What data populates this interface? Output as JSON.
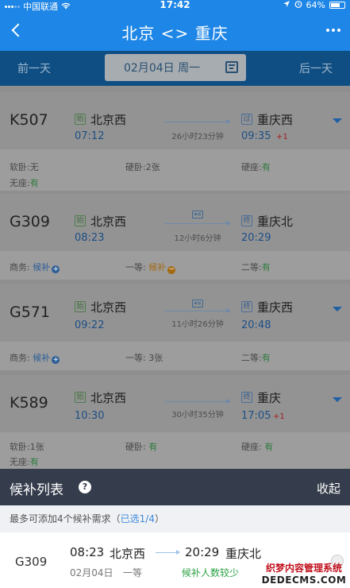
{
  "status_bar": {
    "carrier": "中国联通",
    "time": "17:42",
    "battery": "64%"
  },
  "header": {
    "title": "北京 <> 重庆"
  },
  "date_nav": {
    "prev": "前一天",
    "date": "02月04日 周一",
    "next": "后一天"
  },
  "badges": {
    "origin": "始",
    "pass": "过",
    "terminal": "终"
  },
  "trains": [
    {
      "number": "K507",
      "from_station": "北京西",
      "from_time": "07:12",
      "duration": "26小时23分钟",
      "to_station": "重庆西",
      "to_time": "09:35",
      "day_offset": "+1",
      "seats_row1": [
        {
          "label": "软卧:",
          "value": "无"
        },
        {
          "label": "硬卧:",
          "value": "2张"
        },
        {
          "label": "硬座:",
          "value": "有"
        }
      ],
      "seats_row2": [
        {
          "label": "无座:",
          "value": "有"
        }
      ]
    },
    {
      "number": "G309",
      "from_station": "北京西",
      "from_time": "08:23",
      "duration": "12小时6分钟",
      "to_station": "重庆北",
      "to_time": "20:29",
      "seats_row1": [
        {
          "label": "商务:",
          "value": "候补"
        },
        {
          "label": "一等:",
          "value": "候补"
        },
        {
          "label": "二等:",
          "value": "有"
        }
      ]
    },
    {
      "number": "G571",
      "from_station": "北京西",
      "from_time": "09:22",
      "duration": "11小时26分钟",
      "to_station": "重庆西",
      "to_time": "20:48",
      "seats_row1": [
        {
          "label": "商务:",
          "value": "候补"
        },
        {
          "label": "一等:",
          "value": "3张"
        },
        {
          "label": "二等:",
          "value": "有"
        }
      ]
    },
    {
      "number": "K589",
      "from_station": "北京西",
      "from_time": "10:30",
      "duration": "30小时35分钟",
      "to_station": "重庆",
      "to_time": "17:05",
      "day_offset": "+1",
      "seats_row1": [
        {
          "label": "软卧:",
          "value": "1张"
        },
        {
          "label": "硬卧:",
          "value": "有"
        },
        {
          "label": "硬座:",
          "value": "有"
        }
      ],
      "seats_row2": [
        {
          "label": "无座:",
          "value": "有"
        }
      ]
    }
  ],
  "waitlist": {
    "title": "候补列表",
    "help": "?",
    "collapse": "收起",
    "hint": "最多可添加4个候补需求（",
    "hint_selected": "已选1/4",
    "hint_end": "）",
    "item": {
      "train": "G309",
      "dep_time": "08:23",
      "dep_station": "北京西",
      "arr_time": "20:29",
      "arr_station": "重庆北",
      "date": "02月04日",
      "class": "一等",
      "status": "候补人数较少"
    }
  },
  "watermark": {
    "line1": "织梦内容管理系统",
    "line2": "DEDECMS.COM"
  },
  "colors": {
    "header_blue": "#1e86e6",
    "panel_dark": "#353c4b",
    "green": "#2ba245"
  }
}
